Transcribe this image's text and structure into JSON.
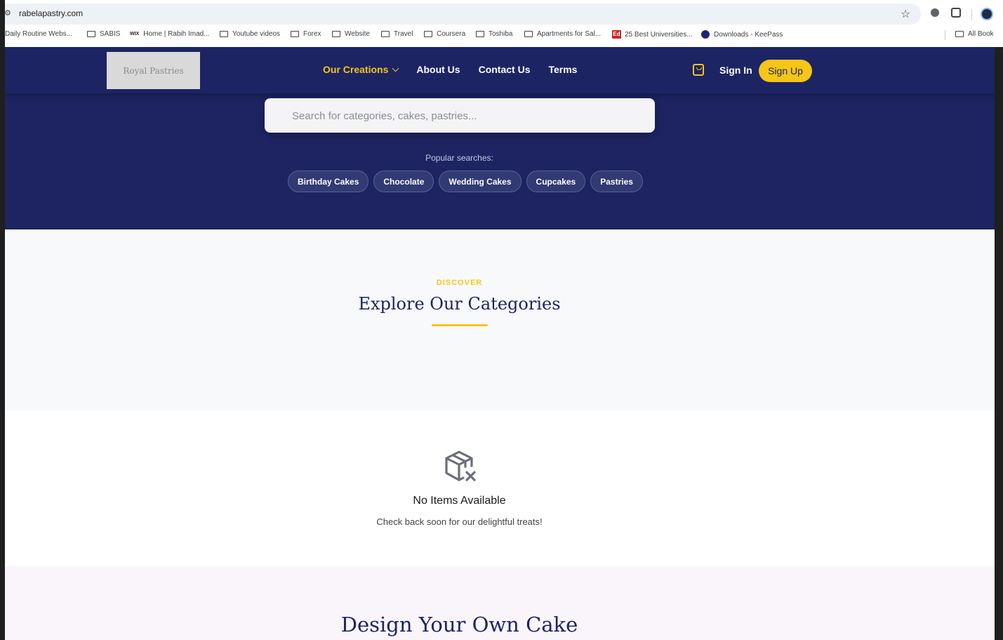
{
  "browser": {
    "url": "rabelapastry.com",
    "bookmarks": [
      {
        "label": "Daily Routine Webs...",
        "icon": "folder-icon"
      },
      {
        "label": "SABIS",
        "icon": "folder-icon"
      },
      {
        "label": "Home | Rabih Imad...",
        "icon": "wix-icon"
      },
      {
        "label": "Youtube videos",
        "icon": "folder-icon"
      },
      {
        "label": "Forex",
        "icon": "folder-icon"
      },
      {
        "label": "Website",
        "icon": "folder-icon"
      },
      {
        "label": "Travel",
        "icon": "folder-icon"
      },
      {
        "label": "Coursera",
        "icon": "folder-icon"
      },
      {
        "label": "Toshiba",
        "icon": "folder-icon"
      },
      {
        "label": "Apartments for Sal...",
        "icon": "folder-icon"
      },
      {
        "label": "25 Best Universities...",
        "icon": "ed-icon"
      },
      {
        "label": "Downloads - KeePass",
        "icon": "keepass-icon"
      }
    ],
    "all_bookmarks": "All Book"
  },
  "nav": {
    "logo": "Royal Pastries",
    "links": [
      "Our Creations",
      "About Us",
      "Contact Us",
      "Terms"
    ],
    "sign_in": "Sign In",
    "sign_up": "Sign Up"
  },
  "search": {
    "placeholder": "Search for categories, cakes, pastries...",
    "popular_label": "Popular searches:",
    "chips": [
      "Birthday Cakes",
      "Chocolate",
      "Wedding Cakes",
      "Cupcakes",
      "Pastries"
    ]
  },
  "categories": {
    "eyebrow": "DISCOVER",
    "title": "Explore Our Categories"
  },
  "empty_state": {
    "title": "No Items Available",
    "subtitle": "Check back soon for our delightful treats!"
  },
  "design": {
    "title": "Design Your Own Cake"
  },
  "colors": {
    "navy": "#1c2463",
    "gold": "#f5c518"
  }
}
